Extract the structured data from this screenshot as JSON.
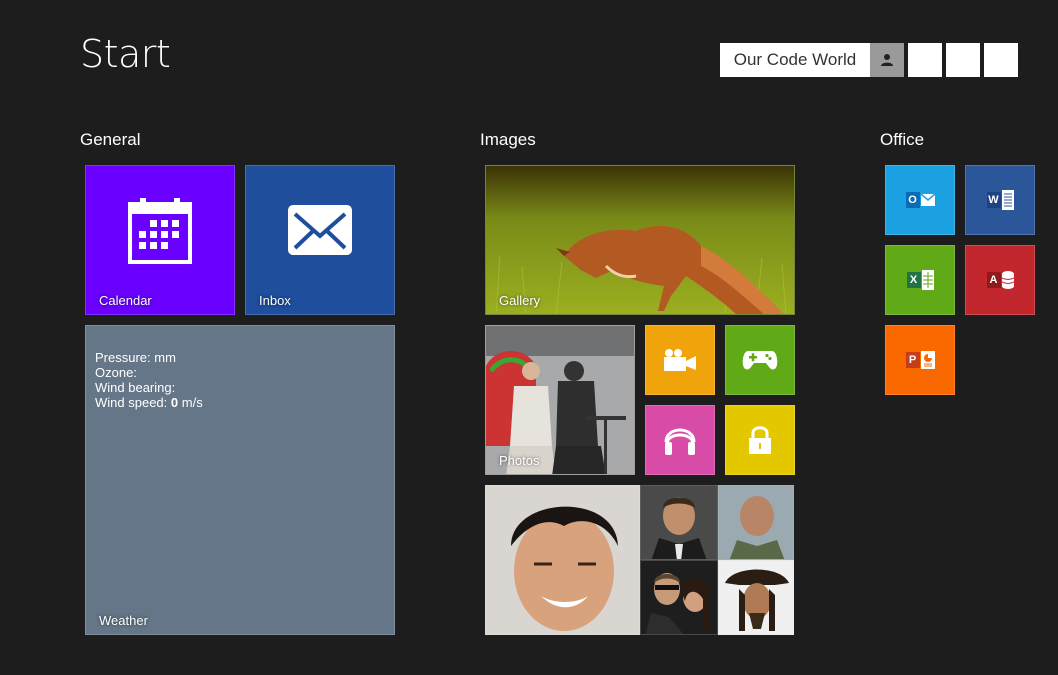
{
  "header": {
    "title": "Start",
    "user_name": "Our Code World"
  },
  "groups": {
    "general": "General",
    "images": "Images",
    "office": "Office"
  },
  "tiles": {
    "calendar": {
      "label": "Calendar",
      "color": "#6a00ff"
    },
    "inbox": {
      "label": "Inbox",
      "color": "#1e4e9c"
    },
    "weather": {
      "label": "Weather",
      "color": "#647687",
      "pressure_label": "Pressure: mm",
      "ozone_label": "Ozone:",
      "wind_bearing_label": "Wind bearing:",
      "wind_speed_label": "Wind speed:",
      "wind_speed_value": "0",
      "wind_speed_unit": "m/s"
    },
    "gallery": {
      "label": "Gallery"
    },
    "photos": {
      "label": "Photos"
    },
    "video": {
      "color": "#f0a30a",
      "icon": "video-camera-icon"
    },
    "games": {
      "color": "#60a917",
      "icon": "gamepad-icon"
    },
    "music": {
      "color": "#d80073",
      "icon": "headphones-icon"
    },
    "lock": {
      "color": "#e3c800",
      "icon": "lock-icon"
    },
    "outlook": {
      "letter": "O",
      "color": "#1ba1e2"
    },
    "word": {
      "letter": "W",
      "color": "#2b579a"
    },
    "excel": {
      "letter": "X",
      "color": "#60a917"
    },
    "access": {
      "letter": "A",
      "color": "#c1272d"
    },
    "powerpoint": {
      "letter": "P",
      "color": "#fa6800"
    }
  }
}
